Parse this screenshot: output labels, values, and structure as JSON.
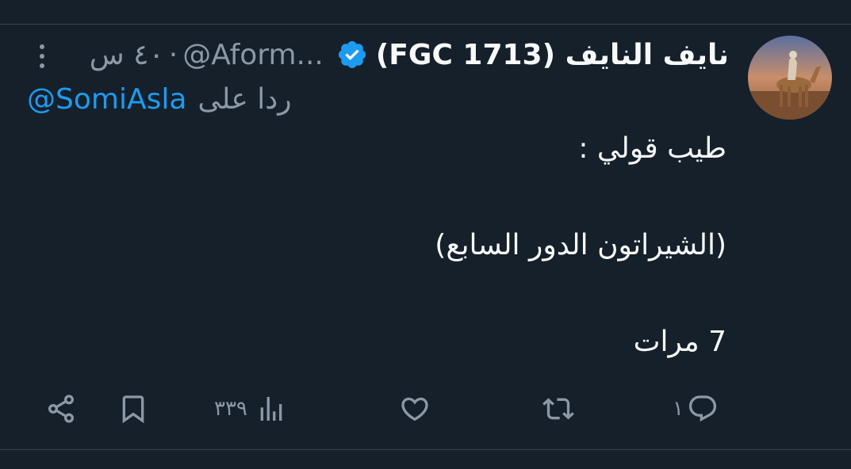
{
  "author": {
    "display_name": "نايف النايف (FGC 1713)",
    "handle": "@Aform...",
    "time": "٤٠ س",
    "verified": true,
    "avatar_icon": "avatar-camel-rider"
  },
  "reply": {
    "prefix": "ردا على",
    "handle": "@SomiAsla"
  },
  "body": {
    "line1": "طيب قولي :",
    "line2": "(الشيراتون الدور السابع)",
    "line3": "7 مرات"
  },
  "actions": {
    "reply_count": "١",
    "retweet_count": "",
    "like_count": "",
    "views_count": "٣٣٩",
    "icons": [
      "reply-icon",
      "retweet-icon",
      "heart-icon",
      "views-icon",
      "bookmark-icon",
      "share-icon"
    ]
  },
  "colors": {
    "background": "#15202b",
    "text": "#f7f9f9",
    "secondary": "#8b98a5",
    "link": "#1d9bf0",
    "divider": "#38444d"
  }
}
